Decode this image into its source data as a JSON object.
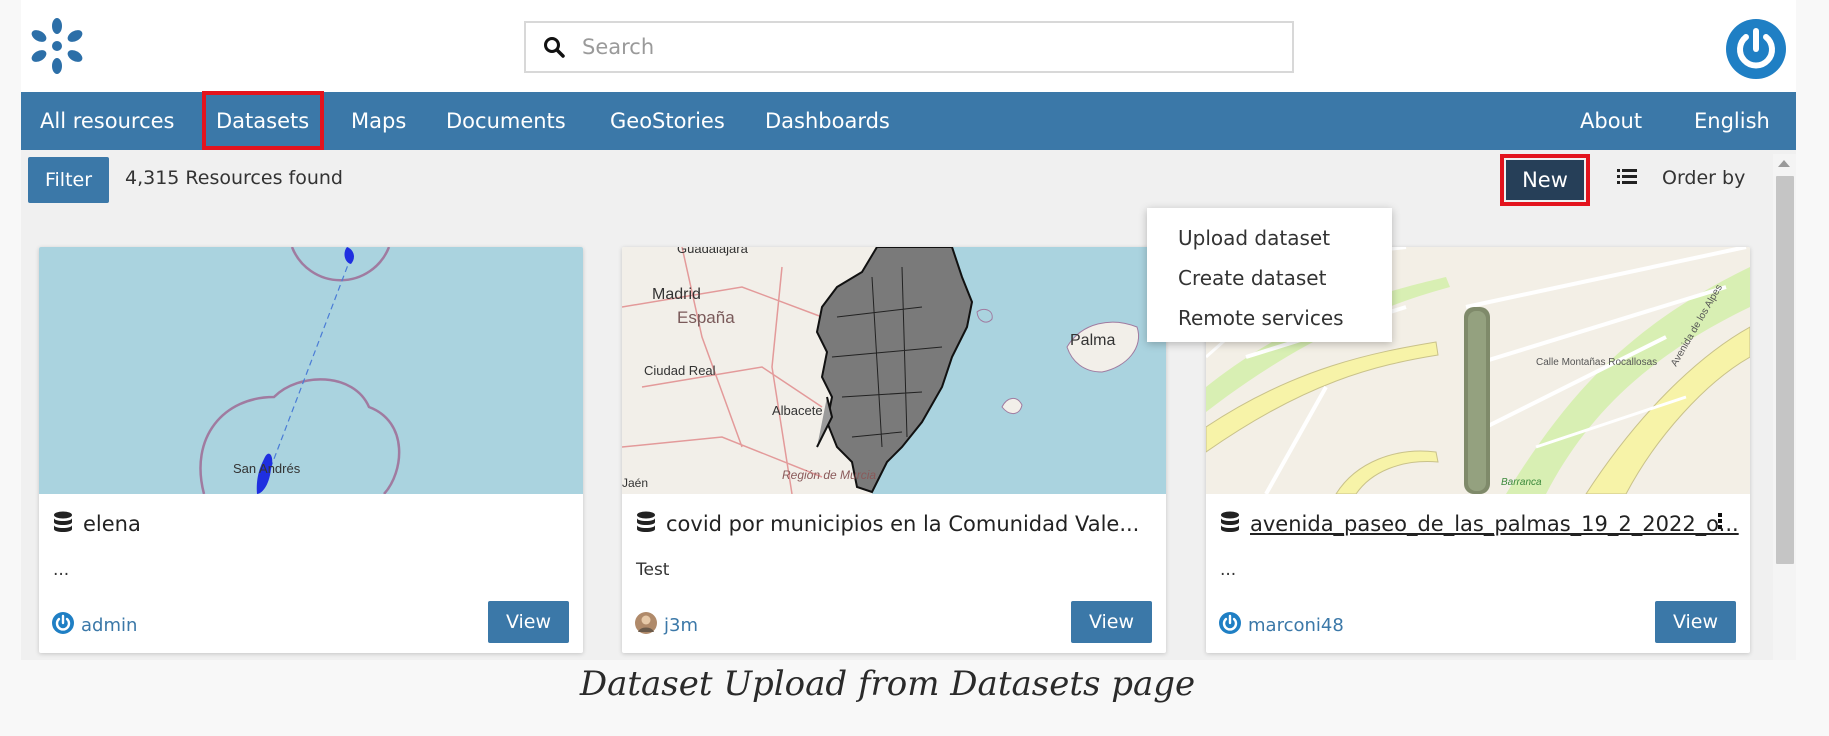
{
  "header": {
    "search_placeholder": "Search"
  },
  "nav": {
    "items": [
      "All resources",
      "Datasets",
      "Maps",
      "Documents",
      "GeoStories",
      "Dashboards"
    ],
    "right_items": [
      "About",
      "English"
    ]
  },
  "toolbar": {
    "filter_label": "Filter",
    "resource_count": "4,315 Resources found",
    "new_label": "New",
    "order_by_label": "Order by"
  },
  "new_menu": {
    "items": [
      "Upload dataset",
      "Create dataset",
      "Remote services"
    ]
  },
  "cards": [
    {
      "title": "elena",
      "description": "...",
      "owner": "admin",
      "view_label": "View",
      "map_label": "San Andrés"
    },
    {
      "title": "covid por municipios en la Comunidad Vale...",
      "description": "Test",
      "owner": "j3m",
      "view_label": "View",
      "map_labels": [
        "Guadalajara",
        "Madrid",
        "España",
        "Ciudad Real",
        "Albacete",
        "Palma",
        "Región de Murcia",
        "Jaén"
      ]
    },
    {
      "title": "avenida_paseo_de_las_palmas_19_2_2022_o...",
      "description": "...",
      "owner": "marconi48",
      "view_label": "View",
      "map_labels": [
        "Calle Montañas Rocallosas",
        "Avenida de los Alpes",
        "Barranca"
      ]
    }
  ],
  "caption": "Dataset Upload from Datasets page",
  "colors": {
    "nav_blue": "#3b78a8",
    "new_button": "#263f58",
    "highlight_red": "#e3141e",
    "sea": "#aad3df"
  }
}
